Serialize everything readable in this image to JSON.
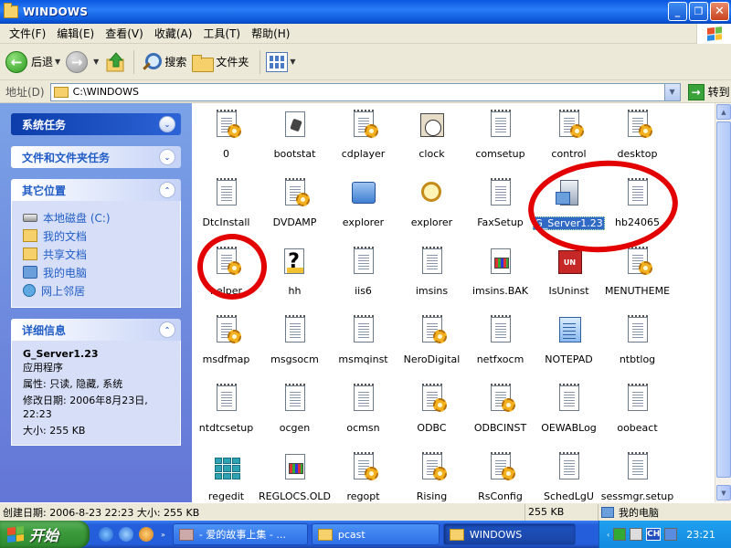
{
  "window": {
    "title": "WINDOWS"
  },
  "menu": [
    "文件(F)",
    "编辑(E)",
    "查看(V)",
    "收藏(A)",
    "工具(T)",
    "帮助(H)"
  ],
  "toolbar": {
    "back": "后退",
    "search": "搜索",
    "folders": "文件夹"
  },
  "address": {
    "label": "地址(D)",
    "value": "C:\\WINDOWS",
    "go": "转到"
  },
  "taskpane": {
    "system_tasks": "系统任务",
    "file_folder_tasks": "文件和文件夹任务",
    "other_places": {
      "title": "其它位置",
      "items": [
        "本地磁盘 (C:)",
        "我的文档",
        "共享文档",
        "我的电脑",
        "网上邻居"
      ]
    },
    "details": {
      "title": "详细信息",
      "name": "G_Server1.23",
      "type": "应用程序",
      "attributes": "属性: 只读, 隐藏, 系统",
      "modified": "修改日期: 2006年8月23日,",
      "modified_time": "22:23",
      "size": "大小: 255 KB"
    }
  },
  "files": [
    {
      "name": "0",
      "icon": "config-file-icon"
    },
    {
      "name": "bootstat",
      "icon": "bootstat-icon"
    },
    {
      "name": "cdplayer",
      "icon": "config-file-icon"
    },
    {
      "name": "clock",
      "icon": "clock-icon"
    },
    {
      "name": "comsetup",
      "icon": "text-file-icon"
    },
    {
      "name": "control",
      "icon": "config-file-icon"
    },
    {
      "name": "desktop",
      "icon": "config-file-icon"
    },
    {
      "name": "DtcInstall",
      "icon": "text-file-icon"
    },
    {
      "name": "DVDAMP",
      "icon": "config-file-icon"
    },
    {
      "name": "explorer",
      "icon": "explorer-exe-icon"
    },
    {
      "name": "explorer",
      "icon": "explorer-scan-icon"
    },
    {
      "name": "FaxSetup",
      "icon": "text-file-icon"
    },
    {
      "name": "G_Server1.23",
      "icon": "server-exe-icon",
      "selected": true
    },
    {
      "name": "hb24065",
      "icon": "text-file-icon"
    },
    {
      "name": "helper",
      "icon": "config-file-icon"
    },
    {
      "name": "hh",
      "icon": "help-exe-icon"
    },
    {
      "name": "iis6",
      "icon": "text-file-icon"
    },
    {
      "name": "imsins",
      "icon": "text-file-icon"
    },
    {
      "name": "imsins.BAK",
      "icon": "bak-file-icon"
    },
    {
      "name": "IsUninst",
      "icon": "uninstall-icon"
    },
    {
      "name": "MENUTHEME",
      "icon": "config-file-icon"
    },
    {
      "name": "msdfmap",
      "icon": "config-file-icon"
    },
    {
      "name": "msgsocm",
      "icon": "text-file-icon"
    },
    {
      "name": "msmqinst",
      "icon": "text-file-icon"
    },
    {
      "name": "NeroDigital",
      "icon": "config-file-icon"
    },
    {
      "name": "netfxocm",
      "icon": "text-file-icon"
    },
    {
      "name": "NOTEPAD",
      "icon": "notepad-icon"
    },
    {
      "name": "ntbtlog",
      "icon": "text-file-icon"
    },
    {
      "name": "ntdtcsetup",
      "icon": "text-file-icon"
    },
    {
      "name": "ocgen",
      "icon": "text-file-icon"
    },
    {
      "name": "ocmsn",
      "icon": "text-file-icon"
    },
    {
      "name": "ODBC",
      "icon": "config-file-icon"
    },
    {
      "name": "ODBCINST",
      "icon": "config-file-icon"
    },
    {
      "name": "OEWABLog",
      "icon": "text-file-icon"
    },
    {
      "name": "oobeact",
      "icon": "text-file-icon"
    },
    {
      "name": "regedit",
      "icon": "regedit-icon"
    },
    {
      "name": "REGLOCS.OLD",
      "icon": "bak-file-icon"
    },
    {
      "name": "regopt",
      "icon": "config-file-icon"
    },
    {
      "name": "Rising",
      "icon": "config-file-icon"
    },
    {
      "name": "RsConfig",
      "icon": "config-file-icon"
    },
    {
      "name": "SchedLgU",
      "icon": "text-file-icon"
    },
    {
      "name": "sessmgr.setup",
      "icon": "text-file-icon"
    }
  ],
  "status": {
    "info": "创建日期: 2006-8-23 22:23 大小: 255 KB",
    "size": "255 KB",
    "zone": "我的电脑"
  },
  "taskbar": {
    "start": "开始",
    "tasks": [
      "- 爱的故事上集 - ...",
      "pcast",
      "WINDOWS"
    ],
    "time": "23:21",
    "ime": "CH"
  },
  "colors": {
    "annotation": "#e30000",
    "selection": "#316ac5"
  }
}
